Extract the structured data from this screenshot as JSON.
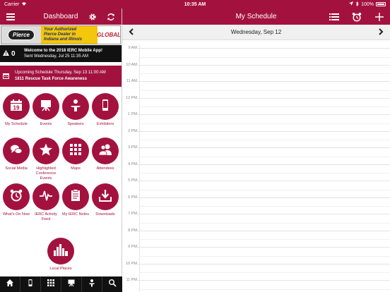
{
  "status_bar": {
    "carrier": "Carrier",
    "time": "10:35 AM",
    "battery": "100%"
  },
  "left": {
    "title": "Dashboard",
    "ad": {
      "logo": "Pierce",
      "line1": "Your Authorized",
      "line2": "Pierce Dealer in",
      "line3": "Indiana and Illinois",
      "brand": "GLOBAL"
    },
    "alert": {
      "count": "0",
      "title": "Welcome to the 2018 IERC Mobile App!",
      "sent": "Sent Wednesday, Jul 25 11:35 AM"
    },
    "schedule": {
      "line1": "Upcoming Schedule Thursday, Sep 13 11:00 AM",
      "line2": "1811 Rescue Task Force Awareness"
    },
    "tiles": [
      {
        "label": "My Schedule",
        "icon": "calendar-icon",
        "badge": "19"
      },
      {
        "label": "Events",
        "icon": "presentation-board-icon"
      },
      {
        "label": "Speakers",
        "icon": "speaker-podium-icon"
      },
      {
        "label": "Exhibitors",
        "icon": "mobile-device-icon"
      },
      {
        "label": "Social Media",
        "icon": "chat-bubbles-icon"
      },
      {
        "label": "Highlighted Conference Events",
        "icon": "star-icon"
      },
      {
        "label": "Maps",
        "icon": "grid-icon"
      },
      {
        "label": "Attendees",
        "icon": "people-icon"
      },
      {
        "label": "What's On Now",
        "icon": "alarm-clock-icon"
      },
      {
        "label": "IERC Activity Feed",
        "icon": "activity-pulse-icon"
      },
      {
        "label": "My IERC Notes",
        "icon": "notes-icon"
      },
      {
        "label": "Downloads",
        "icon": "download-icon"
      },
      {
        "label": "Local Places",
        "icon": "city-skyline-icon"
      }
    ],
    "tabs": [
      "home-icon",
      "mobile-device-icon",
      "grid-icon",
      "presentation-board-icon",
      "speaker-podium-icon",
      "search-icon"
    ]
  },
  "right": {
    "title": "My Schedule",
    "date": "Wednesday, Sep 12",
    "hours": [
      "9 AM",
      "10 AM",
      "11 AM",
      "12 PM",
      "1 PM",
      "2 PM",
      "3 PM",
      "4 PM",
      "5 PM",
      "6 PM",
      "7 PM",
      "8 PM",
      "9 PM",
      "10 PM",
      "11 PM"
    ]
  },
  "colors": {
    "accent": "#a3123f",
    "dark": "#111111"
  }
}
